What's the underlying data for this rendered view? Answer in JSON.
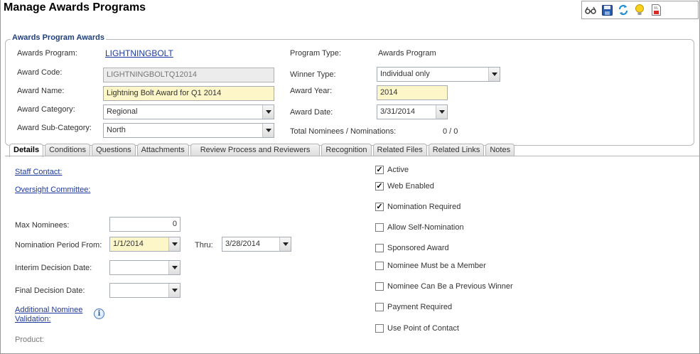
{
  "page": {
    "title": "Manage Awards Programs"
  },
  "toolbar": {
    "icons": [
      "glasses-icon",
      "save-icon",
      "refresh-icon",
      "lightbulb-icon",
      "report-icon"
    ]
  },
  "group": {
    "legend": "Awards Program Awards"
  },
  "header_form": {
    "awards_program_label": "Awards Program:",
    "awards_program_value": "LIGHTNINGBOLT",
    "program_type_label": "Program Type:",
    "program_type_value": "Awards Program",
    "award_code_label": "Award Code:",
    "award_code_value": "LIGHTNINGBOLTQ12014",
    "winner_type_label": "Winner Type:",
    "winner_type_value": "Individual only",
    "award_name_label": "Award Name:",
    "award_name_value": "Lightning Bolt Award for Q1 2014",
    "award_year_label": "Award Year:",
    "award_year_value": "2014",
    "award_category_label": "Award Category:",
    "award_category_value": "Regional",
    "award_date_label": "Award Date:",
    "award_date_value": "3/31/2014",
    "award_subcategory_label": "Award Sub-Category:",
    "award_subcategory_value": "North",
    "total_nominees_label": "Total Nominees / Nominations:",
    "total_nominees_value": "0 / 0"
  },
  "tabs": [
    {
      "label": "Details",
      "active": true
    },
    {
      "label": "Conditions"
    },
    {
      "label": "Questions"
    },
    {
      "label": "Attachments"
    },
    {
      "label": "Review Process and Reviewers"
    },
    {
      "label": "Recognition"
    },
    {
      "label": "Related Files"
    },
    {
      "label": "Related Links"
    },
    {
      "label": "Notes"
    }
  ],
  "details": {
    "staff_contact": "Staff Contact:",
    "oversight_committee": "Oversight Committee:",
    "max_nominees_label": "Max Nominees:",
    "max_nominees_value": "0",
    "nomination_from_label": "Nomination Period From:",
    "nomination_from_value": "1/1/2014",
    "thru_label": "Thru:",
    "thru_value": "3/28/2014",
    "interim_label": "Interim Decision Date:",
    "interim_value": "",
    "final_label": "Final Decision Date:",
    "final_value": "",
    "additional_validation_line1": "Additional Nominee",
    "additional_validation_line2": "Validation:",
    "product_label": "Product:"
  },
  "checkboxes": [
    {
      "label": "Active",
      "checked": true
    },
    {
      "label": "Web Enabled",
      "checked": true
    },
    {
      "label": "Nomination Required",
      "checked": true
    },
    {
      "label": "Allow Self-Nomination",
      "checked": false
    },
    {
      "label": "Sponsored Award",
      "checked": false
    },
    {
      "label": "Nominee Must be a Member",
      "checked": false
    },
    {
      "label": "Nominee Can Be a Previous Winner",
      "checked": false
    },
    {
      "label": "Payment Required",
      "checked": false
    },
    {
      "label": "Use Point of Contact",
      "checked": false
    }
  ]
}
